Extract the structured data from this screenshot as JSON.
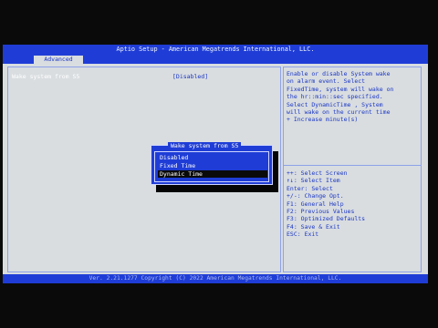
{
  "window": {
    "title": "Aptio Setup - American Megatrends International, LLC."
  },
  "tabs": [
    {
      "label": "Advanced"
    }
  ],
  "main": {
    "setting": {
      "label": "Wake system from S5",
      "value": "[Disabled]"
    }
  },
  "help": {
    "text": "Enable or disable System wake\non alarm event. Select\nFixedTime, system will wake on\nthe hr::min::sec specified.\nSelect DynamicTime , System\nwill wake on the current time\n+ Increase minute(s)",
    "keys": [
      "++: Select Screen",
      "↑↓: Select Item",
      "Enter: Select",
      "+/-: Change Opt.",
      "F1: General Help",
      "F2: Previous Values",
      "F3: Optimized Defaults",
      "F4: Save & Exit",
      "ESC: Exit"
    ]
  },
  "popup": {
    "title": "Wake system from S5",
    "options": [
      "Disabled",
      "Fixed Time",
      "Dynamic Time"
    ],
    "selected_index": 2
  },
  "footer": {
    "text": "Ver. 2.21.1277 Copyright (C) 2022 American Megatrends International, LLC."
  }
}
